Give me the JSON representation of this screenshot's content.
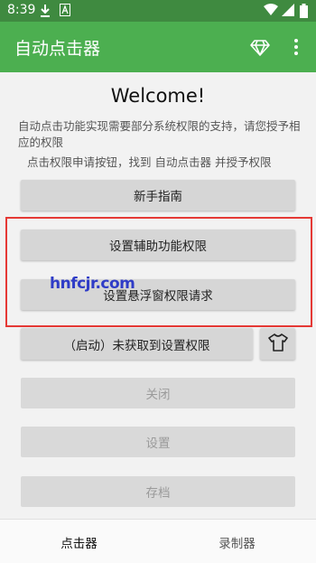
{
  "status_bar": {
    "time": "8:39",
    "icons": [
      "download-icon",
      "a-icon",
      "wifi-icon",
      "signal-icon",
      "battery-icon"
    ]
  },
  "app_bar": {
    "title": "自动点击器",
    "actions": [
      "diamond-icon",
      "more-vert-icon"
    ]
  },
  "main": {
    "welcome": "Welcome!",
    "description": "自动点击功能实现需要部分系统权限的支持，请您授予相应的权限",
    "instruction": "点击权限申请按钮，找到 自动点击器 并授予权限",
    "buttons": {
      "guide": "新手指南",
      "accessibility": "设置辅助功能权限",
      "overlay": "设置悬浮窗权限请求",
      "start": "（启动）未获取到设置权限",
      "close": "关闭",
      "settings": "设置",
      "archive": "存档"
    },
    "watermark": "hnfcjr.com"
  },
  "bottom_nav": {
    "tab_clicker": "点击器",
    "tab_recorder": "录制器"
  },
  "colors": {
    "appbar": "#4caf50",
    "statusbar": "#3f8a40",
    "highlight": "#e53935"
  }
}
